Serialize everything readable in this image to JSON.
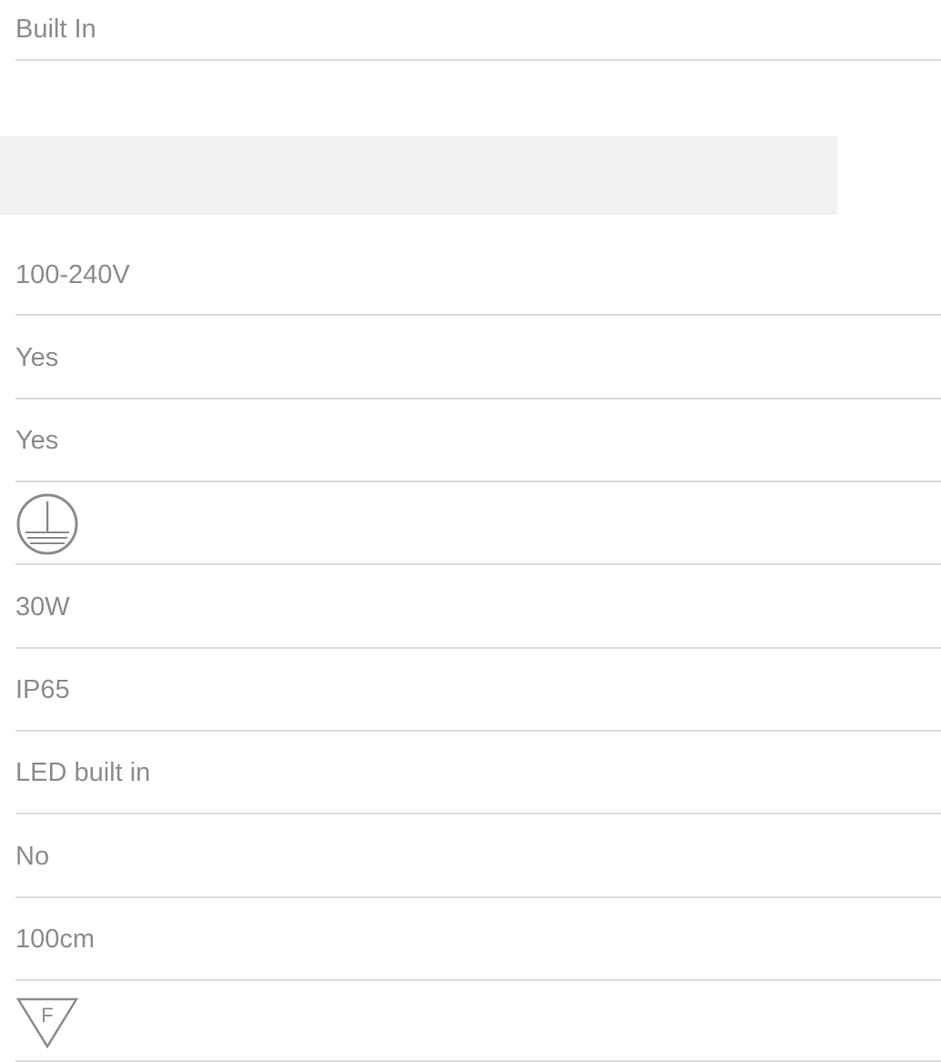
{
  "spec_rows_top": [
    {
      "value": "Built In"
    }
  ],
  "spec_rows": [
    {
      "value": "100-240V"
    },
    {
      "value": "Yes"
    },
    {
      "value": "Yes"
    },
    {
      "icon": "earth-ground-icon"
    },
    {
      "value": "30W"
    },
    {
      "value": "IP65"
    },
    {
      "value": "LED built in"
    },
    {
      "value": "No"
    },
    {
      "value": "100cm"
    },
    {
      "icon": "f-mark-triangle-icon",
      "icon_letter": "F"
    }
  ],
  "colors": {
    "text": "#8c8c8c",
    "divider": "#dcdcdc",
    "band": "#f2f2f2",
    "icon_stroke": "#8c8c8c"
  }
}
